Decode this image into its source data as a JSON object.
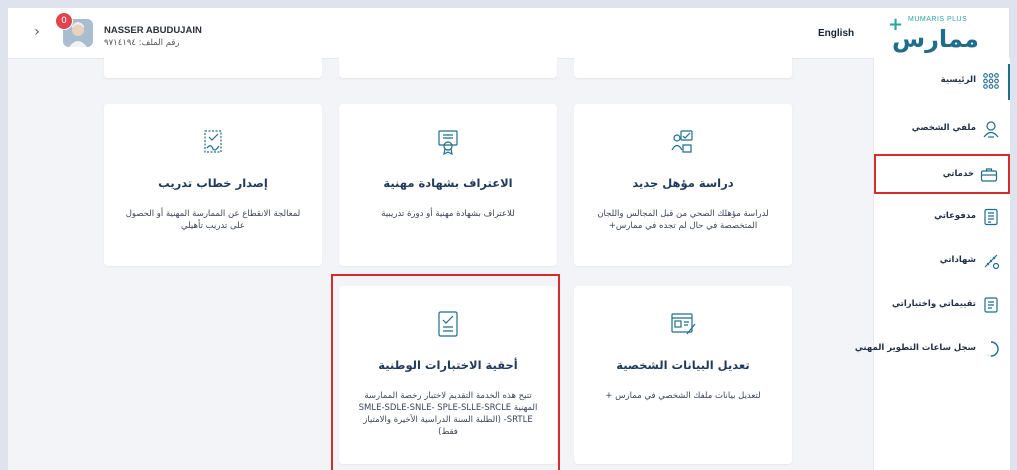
{
  "header": {
    "notification_count": "0",
    "user_name": "NASSER ABUDUJAIN",
    "file_number_label": "رقم الملف: ٩٧١٤١٩٤",
    "language_link": "English",
    "logo_en": "MUMARIS PLUS",
    "logo_ar": "ممارس"
  },
  "sidebar": {
    "items": [
      {
        "label": "الرئيسية",
        "icon": "grid-icon"
      },
      {
        "label": "ملفي الشخصي",
        "icon": "user-icon"
      },
      {
        "label": "خدماتي",
        "icon": "briefcase-icon"
      },
      {
        "label": "مدفوعاتي",
        "icon": "receipt-icon"
      },
      {
        "label": "شهاداتي",
        "icon": "certificate-icon"
      },
      {
        "label": "تقييماتي واختباراتي",
        "icon": "exam-icon"
      },
      {
        "label": "سجل ساعات التطوير المهني",
        "icon": "clock-progress-icon"
      }
    ]
  },
  "cards": [
    {
      "title": "دراسة مؤهل جديد",
      "desc": "لدراسة مؤهلك الصحي من قبل المجالس واللجان المتخصصة في حال لم تجده في ممارس+",
      "icon": "new-qualification-icon"
    },
    {
      "title": "الاعتراف بشهادة مهنية",
      "desc": "للاعتراف بشهادة مهنية أو دورة تدريبية",
      "icon": "certificate-badge-icon"
    },
    {
      "title": "إصدار خطاب تدريب",
      "desc": "لمعالجة الانقطاع عن الممارسة المهنية أو الحصول على تدريب تأهيلي",
      "icon": "signed-letter-icon"
    },
    {
      "title": "تعديل البيانات الشخصية",
      "desc": "لتعديل بيانات ملفك الشخصي في ممارس +",
      "icon": "edit-profile-icon"
    },
    {
      "title": "أحقية الاختبارات الوطنية",
      "desc": "تتيح هذه الخدمة التقديم لاختبار رخصة الممارسة المهنية SMLE-SDLE-SNLE- SPLE-SLLE-SRCLE -SRTLE (الطلبة السنة الدراسية الأخيرة والامتياز فقط)",
      "icon": "checklist-icon"
    }
  ],
  "colors": {
    "accent": "#1f6d8c",
    "highlight": "#d62c2c",
    "badge": "#e0444e"
  }
}
